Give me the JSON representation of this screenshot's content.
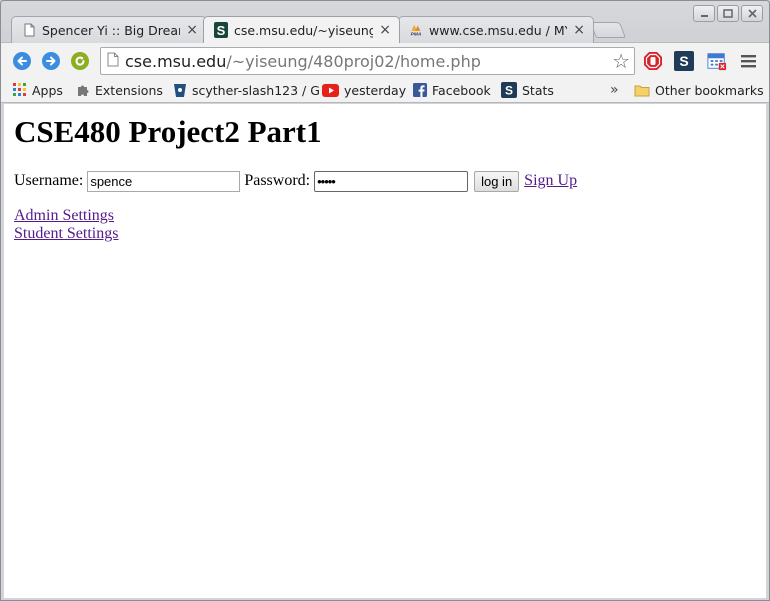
{
  "tabs": [
    {
      "title": "Spencer Yi :: Big Dreame",
      "favicon": "page-icon",
      "active": false
    },
    {
      "title": "cse.msu.edu/~yiseung/",
      "favicon": "msu-s-icon",
      "active": true
    },
    {
      "title": "www.cse.msu.edu / MY",
      "favicon": "phpmyadmin-icon",
      "active": false
    }
  ],
  "tab_close_glyph": "×",
  "toolbar": {
    "url_host": "cse.msu.edu",
    "url_path": "/~yiseung/480proj02/home.php"
  },
  "bookmarks": {
    "items": [
      {
        "label": "Apps",
        "icon": "apps-grid-icon"
      },
      {
        "label": "Extensions",
        "icon": "puzzle-icon"
      },
      {
        "label": "scyther-slash123 / G",
        "icon": "bitbucket-icon"
      },
      {
        "label": "yesterday",
        "icon": "youtube-icon"
      },
      {
        "label": "Facebook",
        "icon": "facebook-icon"
      },
      {
        "label": "Stats",
        "icon": "stats-s-icon"
      }
    ],
    "overflow": "»",
    "other": "Other bookmarks"
  },
  "page": {
    "title": "CSE480 Project2 Part1",
    "username_label": "Username:",
    "username_value": "spence",
    "password_label": "Password:",
    "password_value": "•••••",
    "login_button": "log in",
    "signup_link": "Sign Up",
    "admin_link": "Admin Settings",
    "student_link": "Student Settings"
  },
  "colors": {
    "link_visited": "#551a8b",
    "back_forward": "#3b8de0",
    "reload": "#8dad22"
  }
}
